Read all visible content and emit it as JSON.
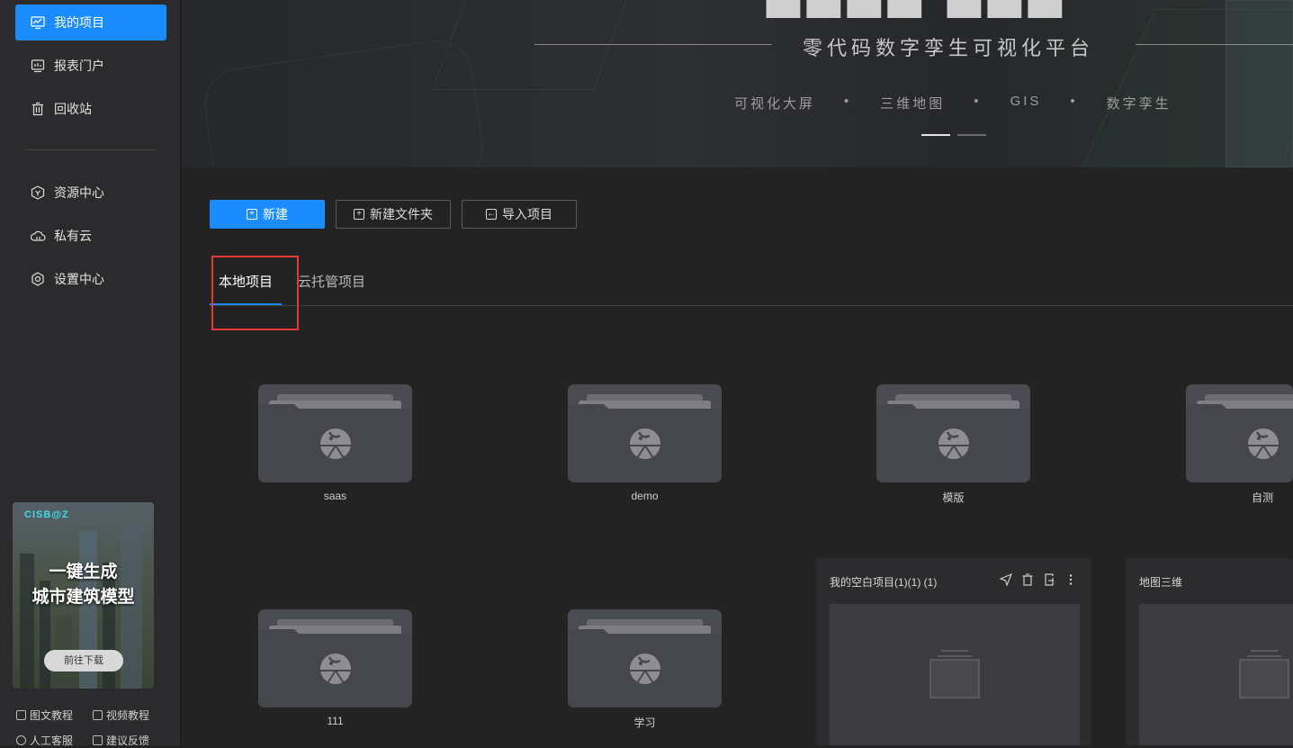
{
  "sidebar": {
    "nav": [
      {
        "label": "我的项目",
        "icon": "chart-line-icon",
        "active": true
      },
      {
        "label": "报表门户",
        "icon": "report-icon",
        "active": false
      },
      {
        "label": "回收站",
        "icon": "trash-icon",
        "active": false
      },
      {
        "label": "资源中心",
        "icon": "hexagon-icon",
        "active": false
      },
      {
        "label": "私有云",
        "icon": "cloud-icon",
        "active": false
      },
      {
        "label": "设置中心",
        "icon": "gear-icon",
        "active": false
      }
    ],
    "promo": {
      "brand": "CISB@Z",
      "line1": "一键生成",
      "line2": "城市建筑模型",
      "button": "前往下载"
    },
    "footer": {
      "link1": "图文教程",
      "link2": "视频教程",
      "link3": "人工客服",
      "link4": "建议反馈"
    }
  },
  "banner": {
    "subtitle": "零代码数字孪生可视化平台",
    "tags": [
      "可视化大屏",
      "三维地图",
      "GIS",
      "数字孪生"
    ],
    "separator": "•"
  },
  "toolbar": {
    "new_label": "新建",
    "new_folder_label": "新建文件夹",
    "import_label": "导入项目"
  },
  "tabs": {
    "local": "本地项目",
    "cloud": "云托管项目"
  },
  "folders": [
    "saas",
    "demo",
    "模版",
    "自测",
    "111",
    "学习"
  ],
  "cards": [
    {
      "title": "我的空白项目(1)(1) (1)"
    },
    {
      "title": "地图三维"
    }
  ],
  "colors": {
    "accent": "#1a8cff",
    "highlight": "#e53935",
    "sidebar_bg": "#2b2b2d",
    "content_bg": "#232323"
  }
}
